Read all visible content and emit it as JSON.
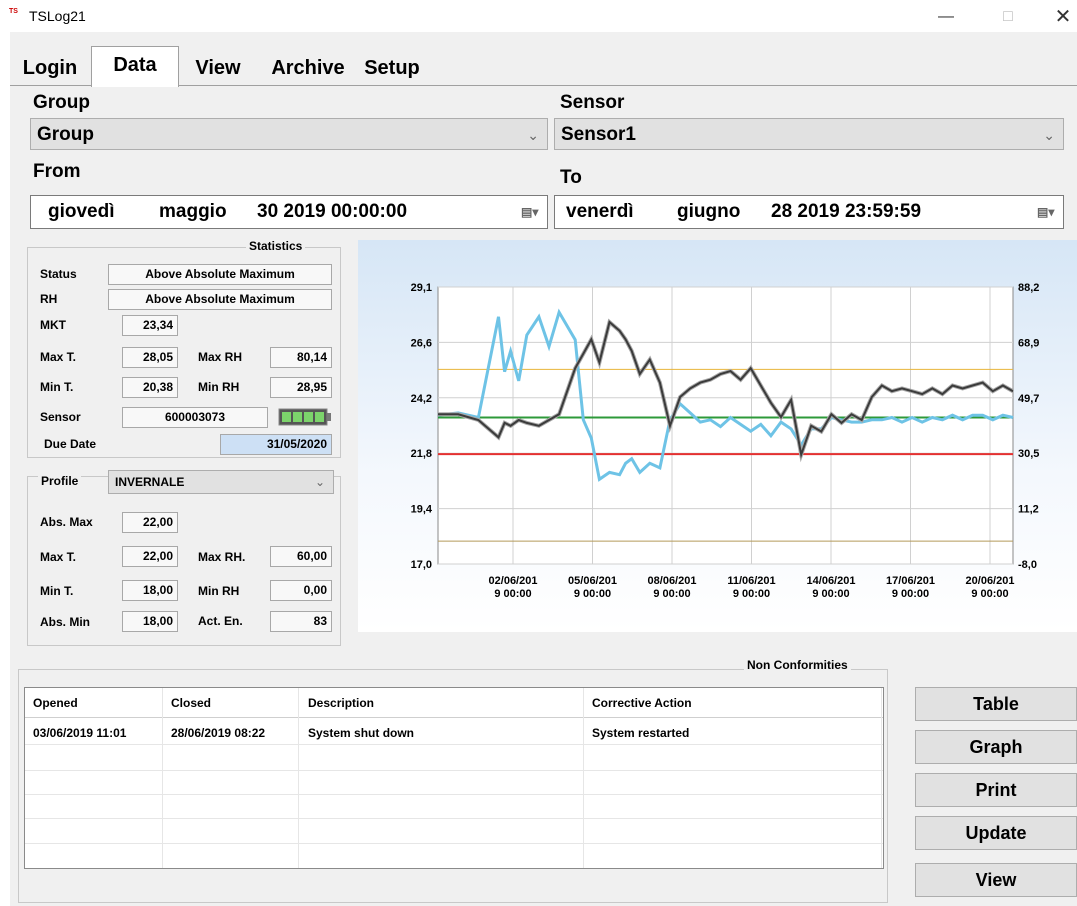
{
  "window": {
    "title": "TSLog21",
    "icon_text": "TS"
  },
  "tabs": [
    {
      "label": "Login"
    },
    {
      "label": "Data"
    },
    {
      "label": "View"
    },
    {
      "label": "Archive"
    },
    {
      "label": "Setup"
    }
  ],
  "filters": {
    "group_label": "Group",
    "group_value": "Group",
    "sensor_label": "Sensor",
    "sensor_value": "Sensor1",
    "from_label": "From",
    "from_day": "giovedì",
    "from_month": "maggio",
    "from_rest": "30 2019 00:00:00",
    "to_label": "To",
    "to_day": "venerdì",
    "to_month": "giugno",
    "to_rest": "28 2019 23:59:59"
  },
  "statistics": {
    "title": "Statistics",
    "status_label": "Status",
    "status_value": "Above Absolute Maximum",
    "rh_label": "RH",
    "rh_value": "Above Absolute Maximum",
    "mkt_label": "MKT",
    "mkt_value": "23,34",
    "maxt_label": "Max T.",
    "maxt_value": "28,05",
    "maxrh_label": "Max RH",
    "maxrh_value": "80,14",
    "mint_label": "Min T.",
    "mint_value": "20,38",
    "minrh_label": "Min RH",
    "minrh_value": "28,95",
    "sensor_label": "Sensor",
    "sensor_value": "600003073",
    "due_label": "Due Date",
    "due_value": "31/05/2020"
  },
  "profile": {
    "label": "Profile",
    "value": "INVERNALE",
    "absmax_label": "Abs. Max",
    "absmax_value": "22,00",
    "maxt_label": "Max T.",
    "maxt_value": "22,00",
    "maxrh_label": "Max RH.",
    "maxrh_value": "60,00",
    "mint_label": "Min T.",
    "mint_value": "18,00",
    "minrh_label": "Min RH",
    "minrh_value": "0,00",
    "absmin_label": "Abs. Min",
    "absmin_value": "18,00",
    "acten_label": "Act. En.",
    "acten_value": "83"
  },
  "chart_data": {
    "type": "line",
    "y_left_ticks": [
      "29,1",
      "26,6",
      "24,2",
      "21,8",
      "19,4",
      "17,0"
    ],
    "y_right_ticks": [
      "88,2",
      "68,9",
      "49,7",
      "30,5",
      "11,2",
      "-8,0"
    ],
    "ylim_left": [
      17.0,
      29.1
    ],
    "ylim_right": [
      -8.0,
      88.2
    ],
    "x_ticks": [
      [
        "02/06/201",
        "9 00:00"
      ],
      [
        "05/06/201",
        "9 00:00"
      ],
      [
        "08/06/201",
        "9 00:00"
      ],
      [
        "11/06/201",
        "9 00:00"
      ],
      [
        "14/06/201",
        "9 00:00"
      ],
      [
        "17/06/201",
        "9 00:00"
      ],
      [
        "20/06/201",
        "9 00:00"
      ]
    ],
    "x_days": [
      0,
      1,
      2,
      3,
      3.3,
      3.6,
      4,
      4.4,
      5,
      5.5,
      6,
      6.8,
      7.2,
      7.6,
      8.0,
      8.5,
      9,
      9.3,
      9.6,
      10,
      10.5,
      11,
      11.5,
      12,
      12.5,
      13,
      13.5,
      14,
      14.5,
      15,
      15.5,
      16,
      16.5,
      17,
      17.5,
      18,
      18.5,
      19,
      19.5,
      20,
      20.5,
      21,
      21.5,
      22,
      22.5,
      23,
      23.5,
      24,
      24.5,
      25,
      25.5,
      26,
      26.5,
      27,
      27.5,
      28,
      28.5
    ],
    "series": [
      {
        "axis": "left",
        "color": "#6ec3e6",
        "values": [
          23.5,
          23.6,
          23.4,
          27.8,
          25.4,
          26.3,
          25.0,
          27.0,
          27.8,
          26.5,
          28.0,
          26.8,
          23.3,
          22.5,
          20.7,
          21.0,
          20.9,
          21.4,
          21.6,
          21.0,
          21.4,
          21.2,
          23.3,
          24.0,
          23.6,
          23.2,
          23.3,
          23.0,
          23.4,
          23.1,
          22.8,
          23.1,
          22.6,
          23.2,
          22.9,
          22.2,
          22.9,
          22.9,
          23.4,
          23.3,
          23.2,
          23.2,
          23.3,
          23.3,
          23.4,
          23.2,
          23.4,
          23.2,
          23.4,
          23.3,
          23.5,
          23.3,
          23.5,
          23.5,
          23.3,
          23.5,
          23.4
        ]
      },
      {
        "axis": "right",
        "color": "#3b3b3b",
        "values": [
          44,
          44,
          42,
          36,
          41,
          40,
          42,
          41,
          40,
          42,
          44,
          60,
          65,
          70,
          62,
          76,
          73,
          70,
          66,
          58,
          63,
          55,
          40,
          50,
          53,
          55,
          56,
          58,
          59,
          56,
          60,
          54,
          48,
          43,
          49,
          30,
          40,
          38,
          44,
          41,
          44,
          42,
          50,
          54,
          52,
          53,
          52,
          51,
          53,
          51,
          54,
          53,
          54,
          55,
          52,
          54,
          52
        ]
      }
    ],
    "threshold_lines": [
      {
        "value": 25.5,
        "axis": "left",
        "color": "#e8b43a"
      },
      {
        "value": 23.4,
        "axis": "left",
        "color": "#2e9a3a"
      },
      {
        "value": 21.8,
        "axis": "left",
        "color": "#e53030"
      },
      {
        "value": 18.0,
        "axis": "left",
        "color": "#b59a5a"
      }
    ],
    "grid": true
  },
  "non_conformities": {
    "title": "Non Conformities",
    "columns": [
      "Opened",
      "Closed",
      "Description",
      "Corrective Action"
    ],
    "rows": [
      {
        "opened": "03/06/2019 11:01",
        "closed": "28/06/2019 08:22",
        "description": "System shut down",
        "action": "System restarted"
      }
    ]
  },
  "buttons": {
    "table": "Table",
    "graph": "Graph",
    "print": "Print",
    "update": "Update",
    "view": "View"
  },
  "colors": {
    "accent_due": "#cde0f5",
    "rh_line": "#6ec3e6",
    "temp_line": "#3b3b3b"
  }
}
